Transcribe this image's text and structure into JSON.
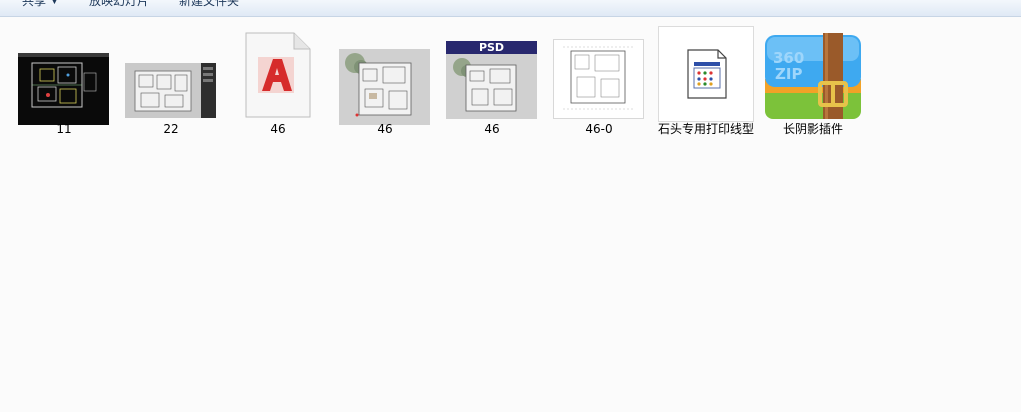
{
  "toolbar": {
    "share_label": "共享",
    "share_caret": "▼",
    "slideshow_label": "放映幻灯片",
    "new_folder_label": "新建文件夹"
  },
  "files": [
    {
      "name": "11",
      "icon": "cad-dark-thumbnail-icon"
    },
    {
      "name": "22",
      "icon": "floorplan-thumbnail-icon"
    },
    {
      "name": "46",
      "icon": "autocad-file-icon"
    },
    {
      "name": "46",
      "icon": "floorplan-color-thumbnail-icon"
    },
    {
      "name": "46",
      "icon": "psd-thumbnail-icon",
      "badge": "PSD"
    },
    {
      "name": "46-0",
      "icon": "floorplan-lineart-thumbnail-icon"
    },
    {
      "name": "石头专用打印线型",
      "icon": "system-file-icon"
    },
    {
      "name": "长阴影插件",
      "icon": "360zip-archive-icon",
      "badge": "360 ZIP"
    }
  ],
  "colors": {
    "background": "#fbfbfb",
    "toolbar_text": "#1e395b",
    "autocad_red": "#d62b2b",
    "psd_banner": "#28286e",
    "zip_blue": "#3ea9f0",
    "zip_strap": "#9a5a2a"
  }
}
